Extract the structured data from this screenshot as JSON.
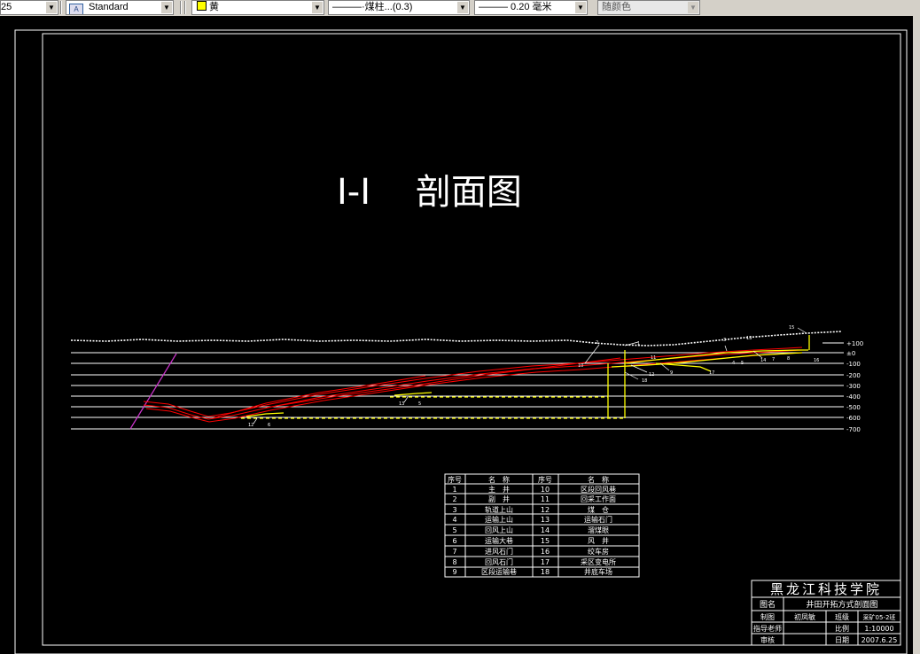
{
  "toolbar": {
    "scale_prefix": "25",
    "text_style": "Standard",
    "color": "黄",
    "linetype": "———·煤柱...(0.3)",
    "lineweight": "——— 0.20 毫米",
    "plot_style": "随颜色"
  },
  "drawing": {
    "title": "I-I    剖面图",
    "elevations": [
      "+100",
      "±0",
      "-100",
      "-200",
      "-300",
      "-400",
      "-500",
      "-600",
      "-700"
    ],
    "markers": [
      "1",
      "2",
      "3",
      "4",
      "5",
      "6",
      "7",
      "8",
      "9",
      "10",
      "11",
      "12",
      "13",
      "14",
      "15",
      "16",
      "17",
      "18"
    ],
    "legend": {
      "headers": [
        "序号",
        "名　称",
        "序号",
        "名　称"
      ],
      "rows": [
        [
          "1",
          "主　井",
          "10",
          "区段回风巷"
        ],
        [
          "2",
          "副　井",
          "11",
          "回采工作面"
        ],
        [
          "3",
          "轨道上山",
          "12",
          "煤　仓"
        ],
        [
          "4",
          "运输上山",
          "13",
          "运输石门"
        ],
        [
          "5",
          "回风上山",
          "14",
          "溜煤眼"
        ],
        [
          "6",
          "运输大巷",
          "15",
          "风　井"
        ],
        [
          "7",
          "进风石门",
          "16",
          "绞车房"
        ],
        [
          "8",
          "回风石门",
          "17",
          "采区变电所"
        ],
        [
          "9",
          "区段运输巷",
          "18",
          "井底车场"
        ]
      ]
    },
    "title_block": {
      "school": "黑龙江科技学院",
      "label_name": "图名",
      "drawing_name": "井田开拓方式剖面图",
      "label_drawn": "制图",
      "drawn_by": "初凤敏",
      "label_class": "班级",
      "class_name": "采矿05-2班",
      "label_teacher": "指导老师",
      "label_scale": "比例",
      "scale": "1:10000",
      "label_review": "审核",
      "label_date": "日期",
      "date": "2007.6.25"
    }
  },
  "colors": {
    "coal_seam": "#ff0000",
    "roadway": "#ffff00",
    "lines": "#ffffff",
    "fault": "#cc33cc"
  }
}
